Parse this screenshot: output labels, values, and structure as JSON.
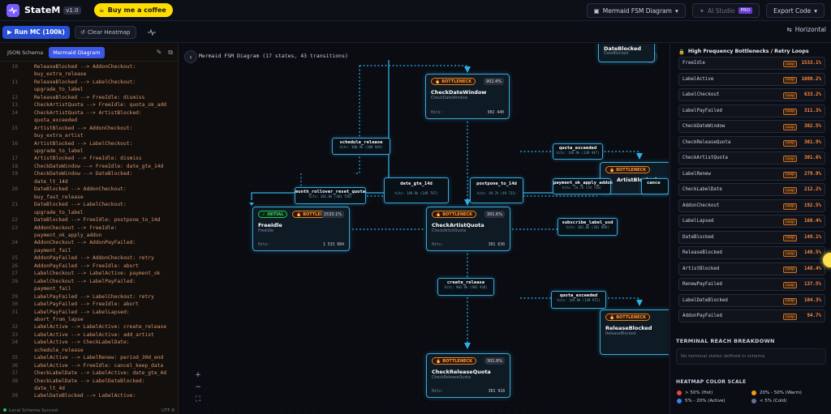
{
  "app": {
    "name": "StateM",
    "version": "v1.0",
    "bmc_label": "Buy me a coffee"
  },
  "topbar": {
    "diagram_select": "Mermaid FSM Diagram",
    "ai_studio": "AI Studio",
    "pro_badge": "PRO",
    "export": "Export Code"
  },
  "toolbar": {
    "run": "Run MC (100k)",
    "clear": "Clear Heatmap",
    "layout": "Horizontal"
  },
  "editor": {
    "tabs": [
      "JSON Schema",
      "Mermaid Diagram"
    ],
    "active_tab": 1,
    "lines": [
      {
        "n": "10",
        "t": "ReleaseBlocked --> AddonCheckout:"
      },
      {
        "n": "",
        "t": "buy_extra_release"
      },
      {
        "n": "11",
        "t": "ReleaseBlocked --> LabelCheckout:"
      },
      {
        "n": "",
        "t": "upgrade_to_label"
      },
      {
        "n": "12",
        "t": "ReleaseBlocked --> FreeIdle: dismiss"
      },
      {
        "n": "13",
        "t": "CheckArtistQuota --> FreeIdle: quota_ok_add"
      },
      {
        "n": "14",
        "t": "CheckArtistQuota --> ArtistBlocked:"
      },
      {
        "n": "",
        "t": "quota_exceeded"
      },
      {
        "n": "15",
        "t": "ArtistBlocked --> AddonCheckout:"
      },
      {
        "n": "",
        "t": "buy_extra_artist"
      },
      {
        "n": "16",
        "t": "ArtistBlocked --> LabelCheckout:"
      },
      {
        "n": "",
        "t": "upgrade_to_label"
      },
      {
        "n": "17",
        "t": "ArtistBlocked --> FreeIdle: dismiss"
      },
      {
        "n": "18",
        "t": "CheckDateWindow --> FreeIdle: date_gte_14d"
      },
      {
        "n": "19",
        "t": "CheckDateWindow --> DateBlocked:"
      },
      {
        "n": "",
        "t": "date_lt_14d"
      },
      {
        "n": "20",
        "t": "DateBlocked --> AddonCheckout:"
      },
      {
        "n": "",
        "t": "buy_fast_release"
      },
      {
        "n": "21",
        "t": "DateBlocked --> LabelCheckout:"
      },
      {
        "n": "",
        "t": "upgrade_to_label"
      },
      {
        "n": "22",
        "t": "DateBlocked --> FreeIdle: postpone_to_14d"
      },
      {
        "n": "23",
        "t": "AddonCheckout --> FreeIdle:"
      },
      {
        "n": "",
        "t": "payment_ok_apply_addon"
      },
      {
        "n": "24",
        "t": "AddonCheckout --> AddonPayFailed:"
      },
      {
        "n": "",
        "t": "payment_fail"
      },
      {
        "n": "25",
        "t": "AddonPayFailed --> AddonCheckout: retry"
      },
      {
        "n": "26",
        "t": "AddonPayFailed --> FreeIdle: abort"
      },
      {
        "n": "27",
        "t": "LabelCheckout --> LabelActive: payment_ok"
      },
      {
        "n": "28",
        "t": "LabelCheckout --> LabelPayFailed:"
      },
      {
        "n": "",
        "t": "payment_fail"
      },
      {
        "n": "29",
        "t": "LabelPayFailed --> LabelCheckout: retry"
      },
      {
        "n": "30",
        "t": "LabelPayFailed --> FreeIdle: abort"
      },
      {
        "n": "31",
        "t": "LabelPayFailed --> LabelLapsed:"
      },
      {
        "n": "",
        "t": "abort_from_lapse"
      },
      {
        "n": "32",
        "t": "LabelActive --> LabelActive: create_release"
      },
      {
        "n": "33",
        "t": "LabelActive --> LabelActive: add_artist"
      },
      {
        "n": "34",
        "t": "LabelActive --> CheckLabelDate:"
      },
      {
        "n": "",
        "t": "schedule_release"
      },
      {
        "n": "35",
        "t": "LabelActive --> LabelRenew: period_30d_end"
      },
      {
        "n": "36",
        "t": "LabelActive --> FreeIdle: cancel_keep_data"
      },
      {
        "n": "37",
        "t": "CheckLabelDate --> LabelActive: date_gte_4d"
      },
      {
        "n": "38",
        "t": "CheckLabelDate --> LabelDateBlocked:"
      },
      {
        "n": "",
        "t": "date_lt_4d"
      },
      {
        "n": "39",
        "t": "LabelDateBlocked --> LabelActive:"
      }
    ],
    "status_left": "Local Schema Synced",
    "status_right": "UTF-8"
  },
  "canvas": {
    "title": "Mermaid FSM Diagram (17 states, 43 transitions)",
    "nodes": {
      "date_blocked": {
        "name": "DateBlocked",
        "sub": "DateBlocked"
      },
      "check_date_window": {
        "badge": "BOTTLENECK",
        "pct": "902.4%",
        "name": "CheckDateWindow",
        "sub": "CheckDateWindow",
        "hits_label": "Hits:",
        "hits": "902 440"
      },
      "free_idle": {
        "badge": "INITIAL",
        "badge2": "BOTTLENECK",
        "pct": "1533.1%",
        "name": "FreeIdle",
        "sub": "FreeIdle",
        "hits_label": "Hits:",
        "hits": "1 533 084"
      },
      "check_artist_quota": {
        "badge": "BOTTLENECK",
        "pct": "301.6%",
        "name": "CheckArtistQuota",
        "sub": "CheckArtistQuota",
        "hits_label": "Hits:",
        "hits": "301 630"
      },
      "artist_blocked": {
        "badge": "BOTTLENECK",
        "name": "ArtistBlocked"
      },
      "release_blocked": {
        "badge": "BOTTLENECK",
        "name": "ReleaseBlocked",
        "sub": "ReleaseBlocked"
      },
      "check_release_quota": {
        "badge": "BOTTLENECK",
        "pct": "301.9%",
        "name": "CheckReleaseQuota",
        "sub": "CheckReleaseQuota",
        "hits_label": "Hits:",
        "hits": "301 918"
      }
    },
    "edges": {
      "schedule_release": {
        "label": "schedule_release",
        "value": "hits: 300.9k (300 949)"
      },
      "month_rollover": {
        "label": "month_rollover_reset_quota",
        "value": "hits: 301.0k (301 750)"
      },
      "date_gte_14d": {
        "label": "date_gte_14d",
        "value": "hits: 149.9k (149 767)"
      },
      "postpone_to_14d": {
        "label": "postpone_to_14d",
        "value": "hits: 49.7k (49 731)"
      },
      "quota_exceeded_top": {
        "label": "quota_exceeded",
        "value": "hits: 149.9k (149 947)"
      },
      "payment_ok_apply_addon": {
        "label": "payment_ok_apply_addon",
        "value": "hits: 54.7k (54 720)"
      },
      "cancel": {
        "label": "cance"
      },
      "subscribe_label_usd": {
        "label": "subscribe_label_usd",
        "value": "hits: 301.0k (301 009)"
      },
      "create_release": {
        "label": "create_release",
        "value": "hits: 903.9k (903 930)"
      },
      "quota_exceeded_bottom": {
        "label": "quota_exceeded",
        "value": "hits: 149.9k (149 972)"
      }
    }
  },
  "sidebar": {
    "title": "High Frequency Bottlenecks / Retry Loops",
    "rows": [
      {
        "name": "FreeIdle",
        "loop": "Loop",
        "value": "1533.1%"
      },
      {
        "name": "LabelActive",
        "loop": "Loop",
        "value": "1080.2%"
      },
      {
        "name": "LabelCheckout",
        "loop": "Loop",
        "value": "633.2%"
      },
      {
        "name": "LabelPayFailed",
        "loop": "Loop",
        "value": "311.3%"
      },
      {
        "name": "CheckDateWindow",
        "loop": "Loop",
        "value": "302.5%"
      },
      {
        "name": "CheckReleaseQuota",
        "loop": "Loop",
        "value": "301.9%"
      },
      {
        "name": "CheckArtistQuota",
        "loop": "Loop",
        "value": "301.6%"
      },
      {
        "name": "LabelRenew",
        "loop": "Loop",
        "value": "279.9%"
      },
      {
        "name": "CheckLabelDate",
        "loop": "Loop",
        "value": "212.2%"
      },
      {
        "name": "AddonCheckout",
        "loop": "Loop",
        "value": "192.5%"
      },
      {
        "name": "LabelLapsed",
        "loop": "Loop",
        "value": "160.4%"
      },
      {
        "name": "DateBlocked",
        "loop": "Loop",
        "value": "149.1%"
      },
      {
        "name": "ReleaseBlocked",
        "loop": "Loop",
        "value": "148.5%"
      },
      {
        "name": "ArtistBlocked",
        "loop": "Loop",
        "value": "148.4%"
      },
      {
        "name": "RenewPayFailed",
        "loop": "Loop",
        "value": "137.5%"
      },
      {
        "name": "LabelDateBlocked",
        "loop": "Loop",
        "value": "104.3%"
      },
      {
        "name": "AddonPayFailed",
        "loop": "Loop",
        "value": "94.7%"
      }
    ],
    "terminal_title": "TERMINAL REACH BREAKDOWN",
    "terminal_note": "No terminal states defined in schema",
    "legend_title": "HEATMAP COLOR SCALE",
    "legend": [
      {
        "label": "> 50% (Hot)",
        "color": "#ef4444"
      },
      {
        "label": "20% - 50% (Warm)",
        "color": "#f59e0b"
      },
      {
        "label": "5% - 20% (Active)",
        "color": "#3b82f6"
      },
      {
        "label": "< 5% (Cold)",
        "color": "#64748b"
      }
    ]
  }
}
